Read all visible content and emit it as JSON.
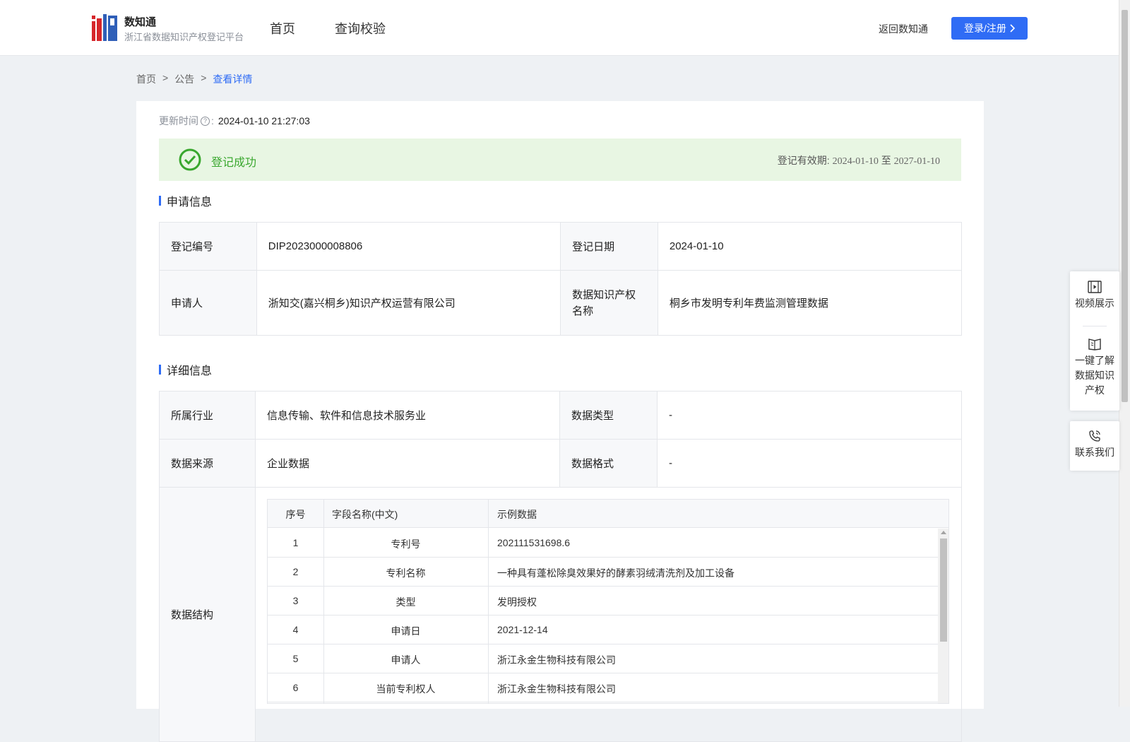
{
  "header": {
    "logo_title": "数知通",
    "logo_subtitle": "浙江省数据知识产权登记平台",
    "nav": [
      "首页",
      "查询校验"
    ],
    "back_link": "返回数知通",
    "login_button": "登录/注册",
    "brand_color": "#2f6cf5"
  },
  "breadcrumb": {
    "items": [
      "首页",
      "公告",
      "查看详情"
    ],
    "separator": ">"
  },
  "update": {
    "label": "更新时间",
    "value": "2024-01-10 21:27:03"
  },
  "status": {
    "text": "登记成功",
    "validity_label": "登记有效期:",
    "validity_start": "2024-01-10",
    "validity_to": "至",
    "validity_end": "2027-01-10",
    "color": "#39a72e"
  },
  "application_info": {
    "title": "申请信息",
    "rows": [
      {
        "k1": "登记编号",
        "v1": "DIP2023000008806",
        "k2": "登记日期",
        "v2": "2024-01-10"
      },
      {
        "k1": "申请人",
        "v1": "浙知交(嘉兴桐乡)知识产权运营有限公司",
        "k2": "数据知识产权名称",
        "v2": "桐乡市发明专利年费监测管理数据"
      }
    ]
  },
  "detail_info": {
    "title": "详细信息",
    "rows": [
      {
        "k1": "所属行业",
        "v1": "信息传输、软件和信息技术服务业",
        "k2": "数据类型",
        "v2": "-"
      },
      {
        "k1": "数据来源",
        "v1": "企业数据",
        "k2": "数据格式",
        "v2": "-"
      }
    ],
    "structure_label": "数据结构",
    "structure": {
      "headers": [
        "序号",
        "字段名称(中文)",
        "示例数据"
      ],
      "rows": [
        [
          "1",
          "专利号",
          "202111531698.6"
        ],
        [
          "2",
          "专利名称",
          "一种具有蓬松除臭效果好的酵素羽绒清洗剂及加工设备"
        ],
        [
          "3",
          "类型",
          "发明授权"
        ],
        [
          "4",
          "申请日",
          "2021-12-14"
        ],
        [
          "5",
          "申请人",
          "浙江永金生物科技有限公司"
        ],
        [
          "6",
          "当前专利权人",
          "浙江永金生物科技有限公司"
        ]
      ]
    }
  },
  "side_panel": {
    "video": "视频展示",
    "learn": [
      "一键了解",
      "数据知识",
      "产权"
    ],
    "contact": "联系我们"
  }
}
